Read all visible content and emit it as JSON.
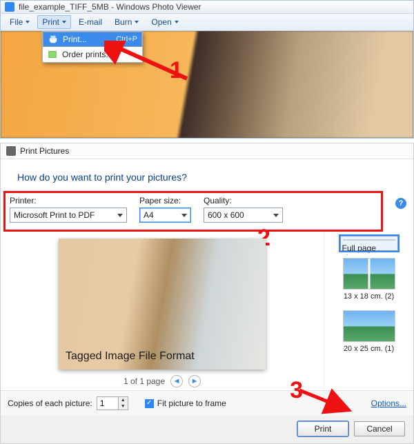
{
  "viewer": {
    "title": "file_example_TIFF_5MB - Windows Photo Viewer",
    "menu": {
      "file": "File",
      "print": "Print",
      "email": "E-mail",
      "burn": "Burn",
      "open": "Open"
    },
    "popup": {
      "print_item": "Print...",
      "print_shortcut": "Ctrl+P",
      "order_item": "Order prints..."
    }
  },
  "callouts": {
    "one": "1",
    "two": "2",
    "three": "3"
  },
  "dialog": {
    "title": "Print Pictures",
    "heading": "How do you want to print your pictures?",
    "printer_label": "Printer:",
    "printer_value": "Microsoft Print to PDF",
    "paper_label": "Paper size:",
    "paper_value": "A4",
    "quality_label": "Quality:",
    "quality_value": "600 x 600",
    "preview_caption": "Tagged Image File Format",
    "pager_text": "1 of 1 page",
    "layouts": {
      "full": "Full page photo",
      "l1": "13 x 18 cm. (2)",
      "l2": "20 x 25 cm. (1)"
    },
    "copies_label": "Copies of each picture:",
    "copies_value": "1",
    "fit_label": "Fit picture to frame",
    "options": "Options...",
    "print_btn": "Print",
    "cancel_btn": "Cancel"
  }
}
